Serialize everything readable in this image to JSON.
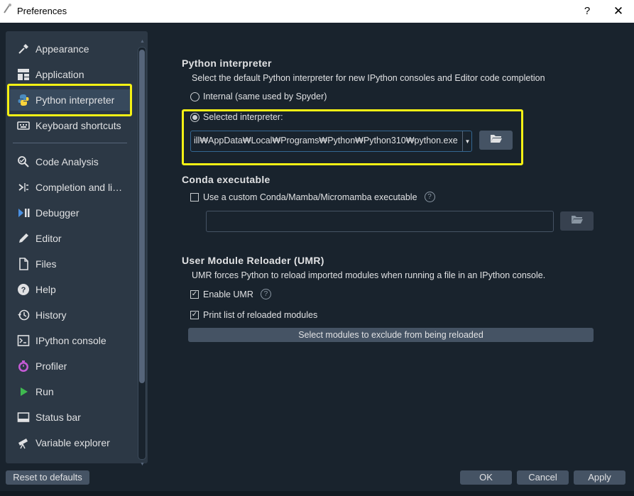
{
  "window": {
    "title": "Preferences",
    "help_glyph": "?",
    "close_glyph": "✕"
  },
  "sidebar": {
    "items": [
      {
        "label": "Appearance",
        "icon": "eyedropper-icon"
      },
      {
        "label": "Application",
        "icon": "application-grid-icon"
      },
      {
        "label": "Python interpreter",
        "icon": "python-logo-icon",
        "selected": true
      },
      {
        "label": "Keyboard shortcuts",
        "icon": "keyboard-icon"
      },
      {
        "label": "Code Analysis",
        "icon": "code-analysis-icon"
      },
      {
        "label": "Completion and li…",
        "icon": "completion-icon"
      },
      {
        "label": "Debugger",
        "icon": "debugger-icon"
      },
      {
        "label": "Editor",
        "icon": "pencil-icon"
      },
      {
        "label": "Files",
        "icon": "file-icon"
      },
      {
        "label": "Help",
        "icon": "question-circle-icon"
      },
      {
        "label": "History",
        "icon": "history-icon"
      },
      {
        "label": "IPython console",
        "icon": "terminal-icon"
      },
      {
        "label": "Profiler",
        "icon": "stopwatch-icon"
      },
      {
        "label": "Run",
        "icon": "play-icon"
      },
      {
        "label": "Status bar",
        "icon": "status-bar-icon"
      },
      {
        "label": "Variable explorer",
        "icon": "telescope-icon"
      }
    ]
  },
  "interpreter": {
    "title": "Python interpreter",
    "description": "Select the default Python interpreter for new IPython consoles and Editor code completion",
    "internal_label": "Internal (same used by Spyder)",
    "selected_label": "Selected interpreter:",
    "selected_option": "selected",
    "path_value": "ill₩AppData₩Local₩Programs₩Python₩Python310₩python.exe"
  },
  "conda": {
    "title": "Conda executable",
    "custom_label": "Use a custom Conda/Mamba/Micromamba executable",
    "custom_checked": false,
    "help_glyph": "?",
    "path_value": ""
  },
  "umr": {
    "title": "User Module Reloader (UMR)",
    "description": "UMR forces Python to reload imported modules when running a file in an IPython console.",
    "enable_label": "Enable UMR",
    "enable_checked": true,
    "print_label": "Print list of reloaded modules",
    "print_checked": true,
    "help_glyph": "?",
    "check_glyph": "✓",
    "exclude_button": "Select modules to exclude from being reloaded"
  },
  "footer": {
    "reset_label": "Reset to defaults",
    "ok_label": "OK",
    "cancel_label": "Cancel",
    "apply_label": "Apply"
  },
  "colors": {
    "background": "#19232d",
    "sidebar": "#2c3845",
    "button": "#455364",
    "accent": "#346792",
    "highlight_annotation": "#f5f114"
  }
}
